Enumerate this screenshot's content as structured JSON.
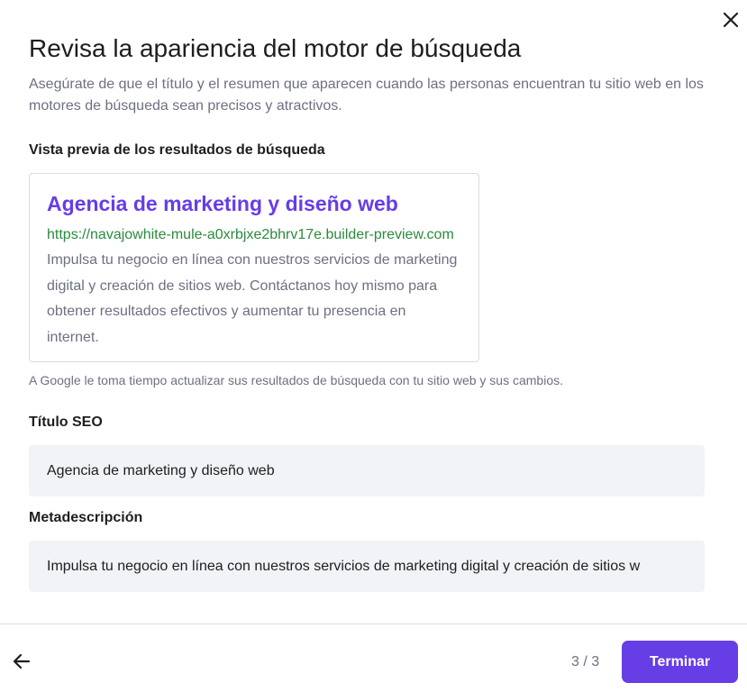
{
  "modal": {
    "title": "Revisa la apariencia del motor de búsqueda",
    "subtitle": "Asegúrate de que el título y el resumen que aparecen cuando las personas encuentran tu sitio web en los motores de búsqueda sean precisos y atractivos.",
    "close_icon": "close-icon"
  },
  "preview": {
    "label": "Vista previa de los resultados de búsqueda",
    "title": "Agencia de marketing y diseño web",
    "url": "https://navajowhite-mule-a0xrbjxe2bhrv17e.builder-preview.com",
    "description": "Impulsa tu negocio en línea con nuestros servicios de marketing digital y creación de sitios web. Contáctanos hoy mismo para obtener resultados efectivos y aumentar tu presencia en internet.",
    "hint": "A Google le toma tiempo actualizar sus resultados de búsqueda con tu sitio web y sus cambios."
  },
  "seo_title": {
    "label": "Título SEO",
    "value": "Agencia de marketing y diseño web"
  },
  "meta_description": {
    "label": "Metadescripción",
    "value": "Impulsa tu negocio en línea con nuestros servicios de marketing digital y creación de sitios w"
  },
  "footer": {
    "back_icon": "arrow-left-icon",
    "step": "3 / 3",
    "finish_label": "Terminar"
  },
  "colors": {
    "accent": "#673de6",
    "url_green": "#2b8a3e",
    "muted_text": "#6d7081",
    "field_bg": "#f2f3f6"
  }
}
